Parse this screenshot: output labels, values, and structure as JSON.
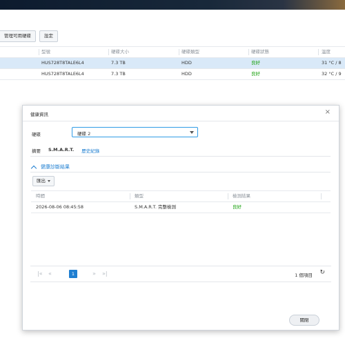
{
  "background": {
    "toolbar": {
      "manage_button": "管理可用硬碟",
      "settings_button": "設定"
    },
    "table": {
      "columns": [
        "型號",
        "硬碟大小",
        "硬碟類型",
        "硬碟狀態",
        "溫度"
      ],
      "rows": [
        {
          "model": "HUS728T8TALE6L4",
          "size": "7.3 TB",
          "type": "HDD",
          "status": "良好",
          "temp": "31 °C / 8"
        },
        {
          "model": "HUS728T8TALE6L4",
          "size": "7.3 TB",
          "type": "HDD",
          "status": "良好",
          "temp": "32 °C / 9"
        }
      ]
    }
  },
  "dialog": {
    "title": "健康資訊",
    "disk_label": "硬碟",
    "disk_value": "硬碟 2",
    "tabs": [
      "摘要",
      "S.M.A.R.T.",
      "歷史紀錄"
    ],
    "section_title": "健康診斷結果",
    "export_button": "匯出",
    "table": {
      "columns": [
        "時間",
        "類型",
        "檢測結果"
      ],
      "rows": [
        {
          "time": "2026-08-06 08:45:58",
          "type": "S.M.A.R.T. 完整檢測",
          "result": "良好"
        }
      ]
    },
    "pagination": {
      "current_page": "1",
      "item_count": "1 個項目"
    },
    "close_button": "關閉"
  },
  "colors": {
    "accent": "#1f7fd1",
    "good": "#19a10f",
    "selected_row": "#d9e9f8"
  }
}
